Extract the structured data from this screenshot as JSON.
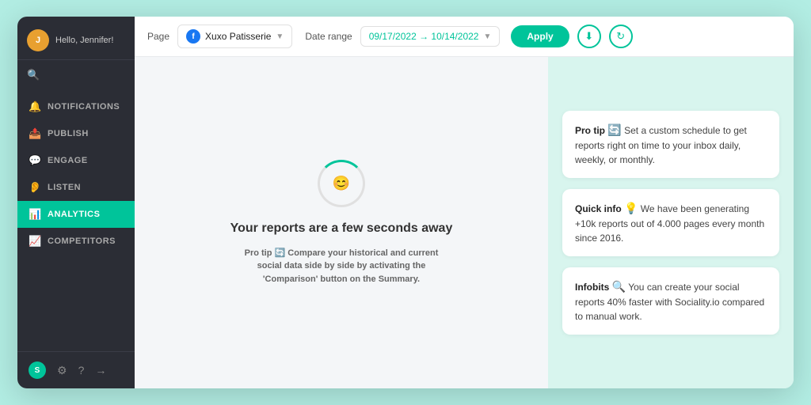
{
  "sidebar": {
    "hello_text": "Hello, Jennifer!",
    "avatar_initials": "J",
    "nav_items": [
      {
        "id": "notifications",
        "label": "Notifications",
        "icon": "🔔",
        "active": false
      },
      {
        "id": "publish",
        "label": "Publish",
        "icon": "📤",
        "active": false
      },
      {
        "id": "engage",
        "label": "Engage",
        "icon": "💬",
        "active": false
      },
      {
        "id": "listen",
        "label": "Listen",
        "icon": "👂",
        "active": false
      },
      {
        "id": "analytics",
        "label": "Analytics",
        "icon": "📊",
        "active": true
      },
      {
        "id": "competitors",
        "label": "Competitors",
        "icon": "📈",
        "active": false
      }
    ],
    "footer_icons": [
      "⚙",
      "?",
      "→"
    ]
  },
  "toolbar": {
    "page_label": "Page",
    "page_name": "Xuxo Patisserie",
    "date_range_label": "Date range",
    "date_range_value": "09/17/2022 → 10/14/2022",
    "apply_label": "Apply",
    "download_icon": "⬇",
    "refresh_icon": "↻"
  },
  "main": {
    "reports_title": "Your reports are a few seconds away",
    "pro_tip_label": "Pro tip",
    "pro_tip_icon": "🔄",
    "pro_tip_text": "Compare your historical and current social data side by side by activating the 'Comparison' button on the Summary."
  },
  "right_panel": {
    "cards": [
      {
        "id": "pro-tip-card",
        "title": "Pro tip",
        "icon": "🔄",
        "text": "Set a custom schedule to get reports right on time to your inbox daily, weekly, or monthly."
      },
      {
        "id": "quick-info-card",
        "title": "Quick info",
        "icon": "💡",
        "text": "We have been generating +10k reports out of 4.000 pages every month since 2016."
      },
      {
        "id": "infobits-card",
        "title": "Infobits",
        "icon": "🔍",
        "text": "You can create your social reports 40% faster with Sociality.io compared to manual work."
      }
    ]
  }
}
